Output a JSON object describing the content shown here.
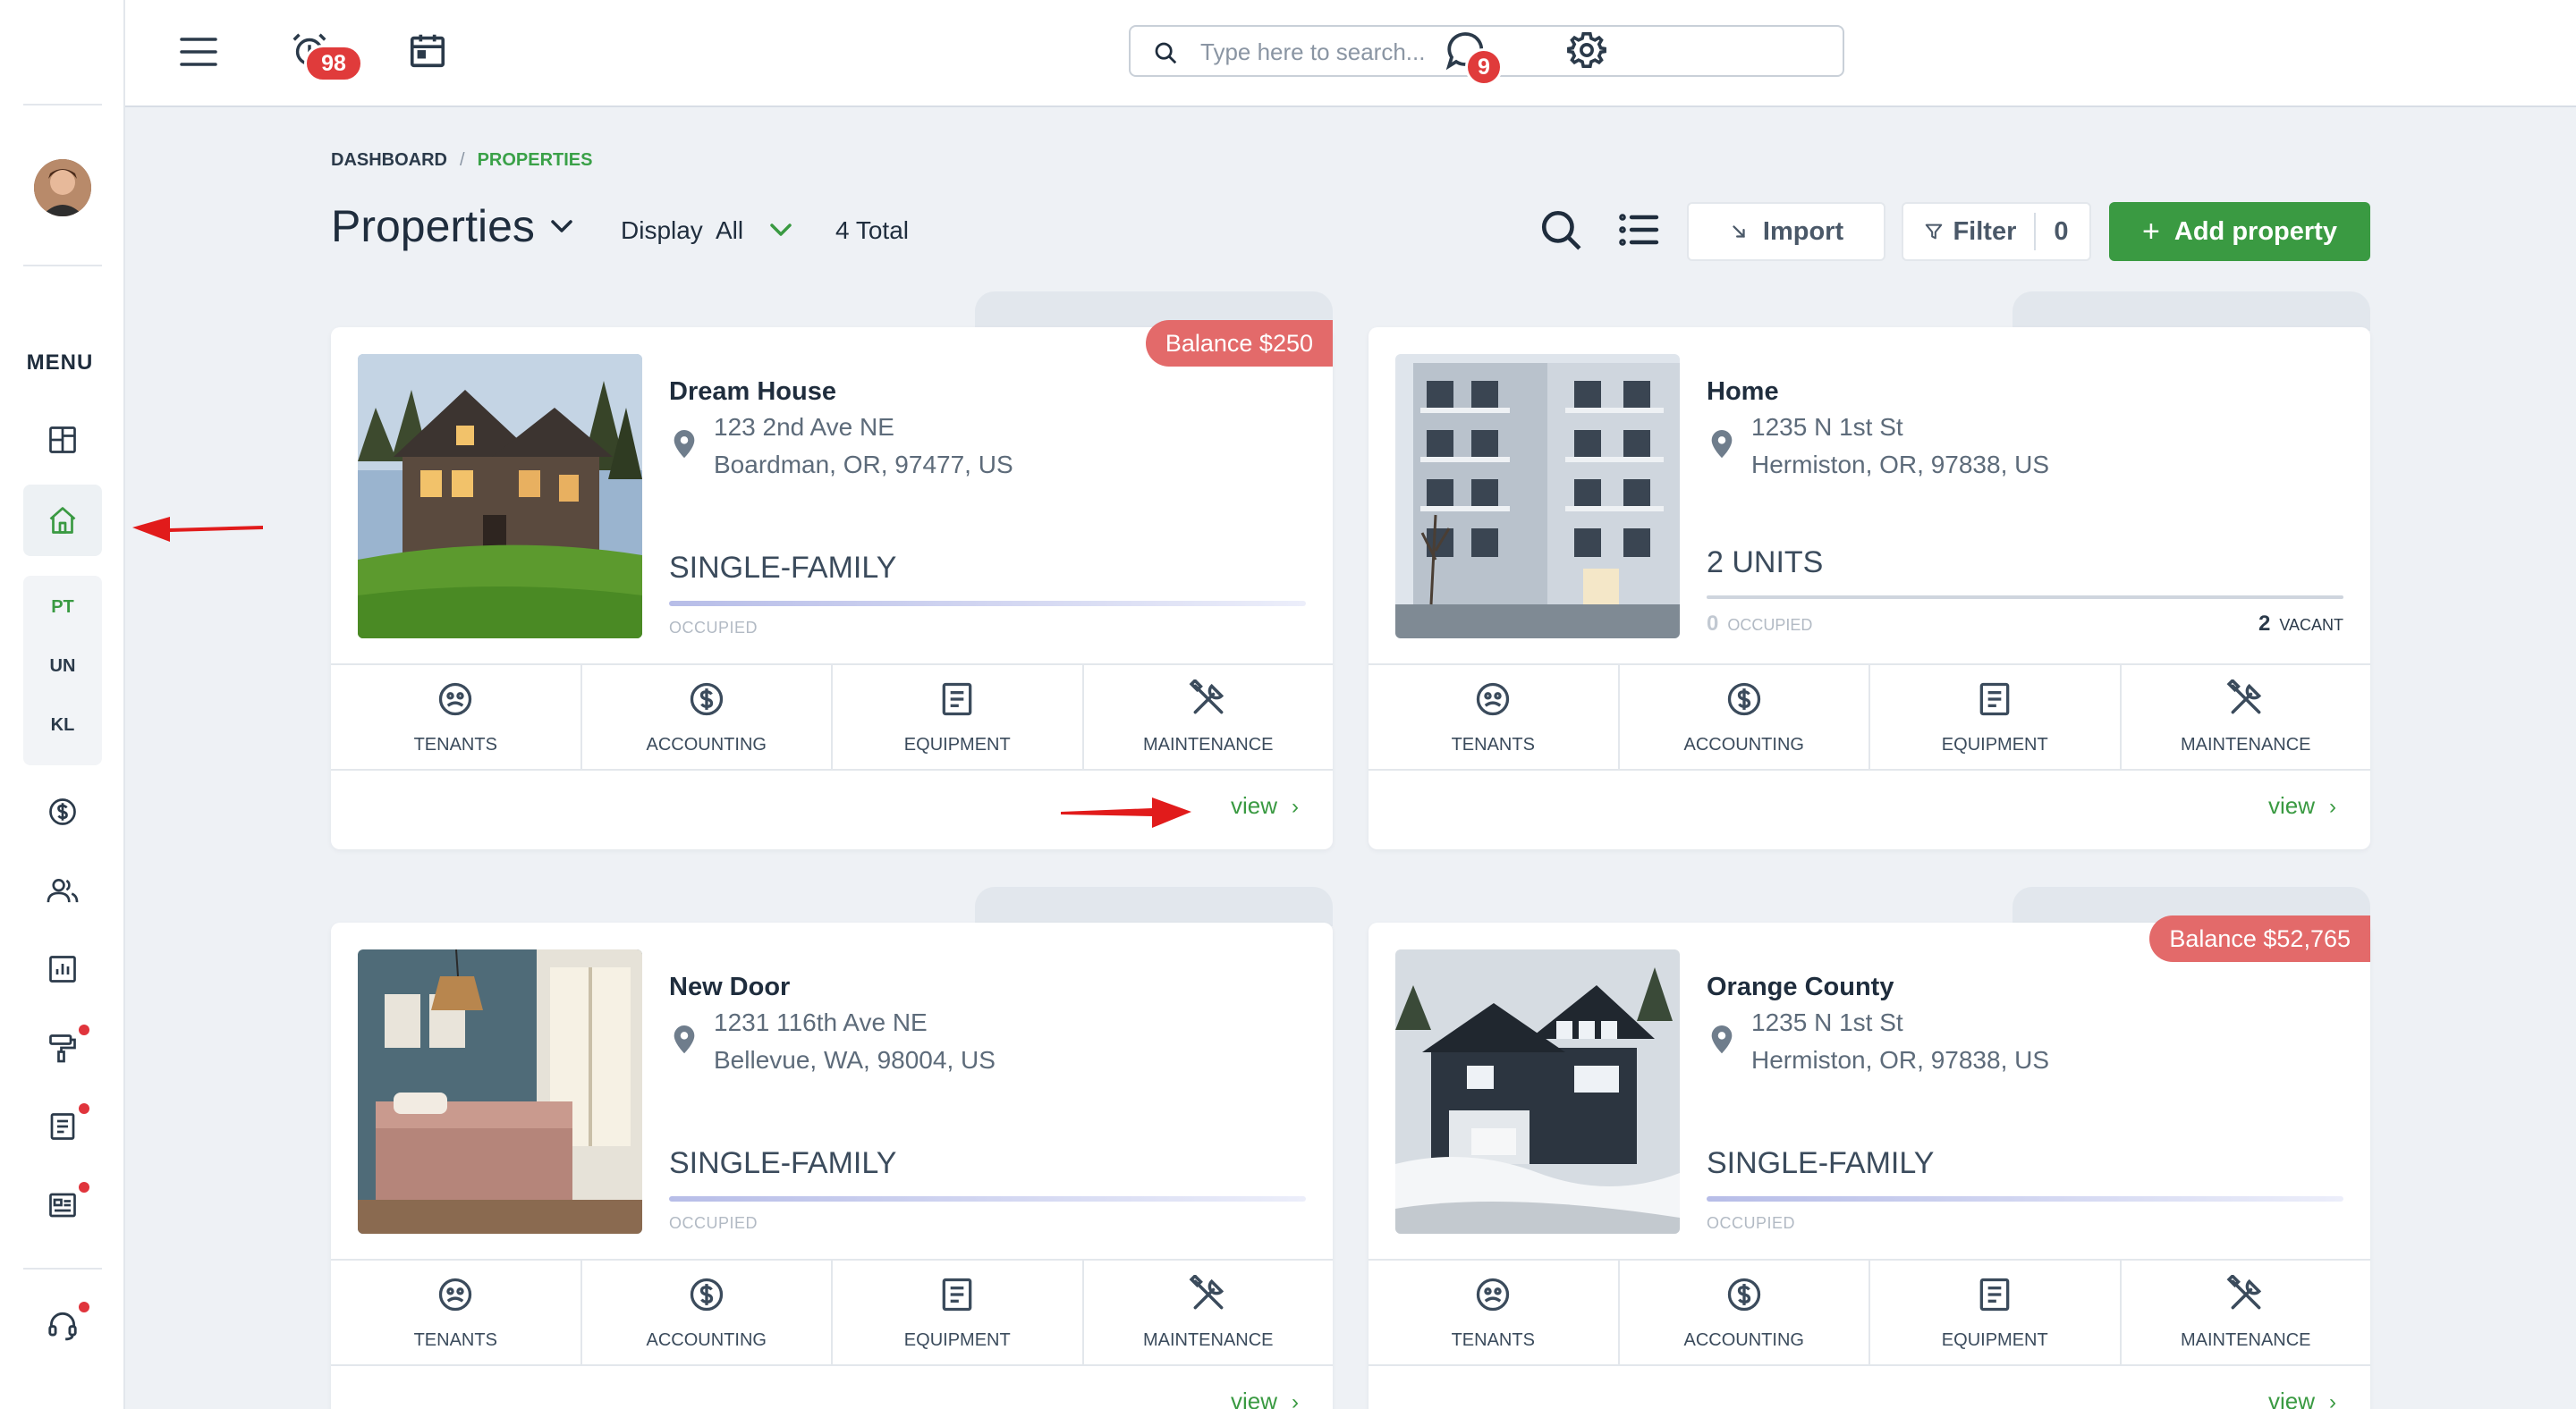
{
  "colors": {
    "accent_green": "#3a9a42",
    "badge_red": "#e03b3b",
    "balance_red": "#e36a6a",
    "arrow_red": "#e11b1b"
  },
  "topbar": {
    "menu_icon": "hamburger-icon",
    "alarm_badge": "98",
    "calendar_icon": "calendar-icon",
    "search_placeholder": "Type here to search...",
    "chat_badge": "9",
    "settings_icon": "gear-icon"
  },
  "sidebar": {
    "menu_label": "MENU",
    "group_items": [
      "PT",
      "UN",
      "KL"
    ],
    "icons": [
      "dashboard-icon",
      "home-icon",
      "dollar-icon",
      "users-icon",
      "report-icon",
      "paint-roller-icon",
      "document-icon",
      "news-icon",
      "headset-icon"
    ]
  },
  "breadcrumb": {
    "first": "DASHBOARD",
    "separator": "/",
    "current": "PROPERTIES"
  },
  "header": {
    "title": "Properties",
    "display_label": "Display",
    "display_value": "All",
    "total": "4 Total",
    "import_label": "Import",
    "filter_label": "Filter",
    "filter_count": "0",
    "add_label": "Add property"
  },
  "actions": {
    "tenants": "TENANTS",
    "accounting": "ACCOUNTING",
    "equipment": "EQUIPMENT",
    "maintenance": "MAINTENANCE",
    "view": "view"
  },
  "properties": [
    {
      "name": "Dream House",
      "address1": "123 2nd Ave NE",
      "address2": "Boardman, OR, 97477, US",
      "type": "SINGLE-FAMILY",
      "status": "OCCUPIED",
      "balance": "Balance $250"
    },
    {
      "name": "Home",
      "address1": "1235 N 1st St",
      "address2": "Hermiston, OR, 97838, US",
      "type": "2 UNITS",
      "occupied_count": "0",
      "occupied_label": "OCCUPIED",
      "vacant_count": "2",
      "vacant_label": "VACANT"
    },
    {
      "name": "New Door",
      "address1": "1231 116th Ave NE",
      "address2": "Bellevue, WA, 98004, US",
      "type": "SINGLE-FAMILY",
      "status": "OCCUPIED"
    },
    {
      "name": "Orange County",
      "address1": "1235 N 1st St",
      "address2": "Hermiston, OR, 97838, US",
      "type": "SINGLE-FAMILY",
      "status": "OCCUPIED",
      "balance": "Balance $52,765"
    }
  ]
}
